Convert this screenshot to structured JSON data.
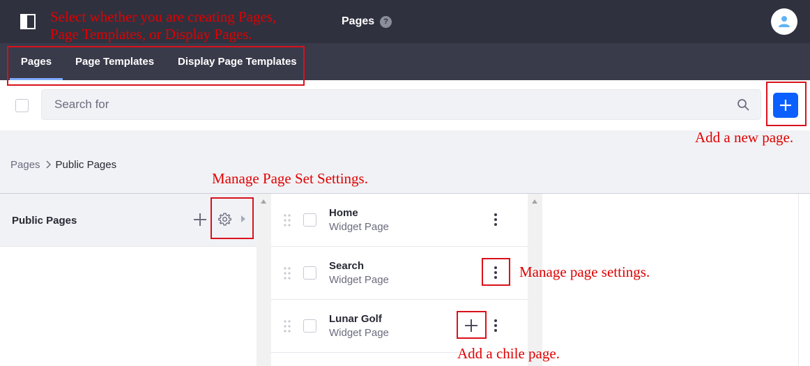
{
  "header": {
    "title": "Pages",
    "help_glyph": "?"
  },
  "tabs": [
    {
      "label": "Pages",
      "active": true
    },
    {
      "label": "Page Templates",
      "active": false
    },
    {
      "label": "Display Page Templates",
      "active": false
    }
  ],
  "search": {
    "placeholder": "Search for"
  },
  "breadcrumb": {
    "root": "Pages",
    "current": "Public Pages"
  },
  "column1": {
    "label": "Public Pages"
  },
  "pages": [
    {
      "title": "Home",
      "type": "Widget Page"
    },
    {
      "title": "Search",
      "type": "Widget Page"
    },
    {
      "title": "Lunar Golf",
      "type": "Widget Page"
    }
  ],
  "annotations": {
    "tabs_note_line1": "Select whether you are creating Pages,",
    "tabs_note_line2": "Page Templates, or Display Pages.",
    "add_page_note": "Add a new page.",
    "page_set_note": "Manage Page Set Settings.",
    "page_settings_note": "Manage page settings.",
    "child_page_note": "Add a chile page."
  },
  "colors": {
    "header_bg": "#30313f",
    "tabbar_bg": "#393a4a",
    "primary": "#0b5fff",
    "annotation": "#e00000"
  }
}
